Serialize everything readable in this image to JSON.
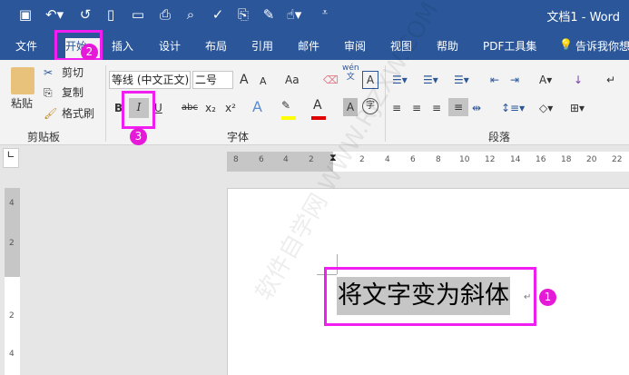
{
  "title": "文档1 - Word",
  "quick_access": [
    "save-icon",
    "undo-icon",
    "redo-icon",
    "new-icon",
    "open-icon",
    "print-icon",
    "preview-icon",
    "spell-icon",
    "attach-icon",
    "edit-icon",
    "touch-icon",
    "customize-icon"
  ],
  "tabs": [
    "文件",
    "开始",
    "插入",
    "设计",
    "布局",
    "引用",
    "邮件",
    "审阅",
    "视图",
    "帮助",
    "PDF工具集"
  ],
  "tell_me": "告诉我你想",
  "clipboard": {
    "paste": "粘贴",
    "cut": "剪切",
    "copy": "复制",
    "format_painter": "格式刷",
    "label": "剪贴板"
  },
  "font": {
    "name": "等线 (中文正文)",
    "size": "二号",
    "bold": "B",
    "italic": "I",
    "underline": "U",
    "strike": "abc",
    "sub": "x₂",
    "sup": "x²",
    "grow": "A",
    "shrink": "A",
    "case": "Aa",
    "pinyin_top": "wén",
    "pinyin_bottom": "文",
    "border_char": "A",
    "effect": "A",
    "shade": "A",
    "circle": "字",
    "label": "字体"
  },
  "paragraph": {
    "label": "段落"
  },
  "ruler_h": [
    "8",
    "6",
    "4",
    "2",
    "2",
    "4",
    "6",
    "8",
    "10",
    "12",
    "14",
    "16",
    "18",
    "20",
    "22"
  ],
  "ruler_v": [
    "4",
    "2",
    "2",
    "4"
  ],
  "document_text": "将文字变为斜体",
  "watermark": "软件自学网 WWW.RJZXW.COM",
  "badges": [
    "1",
    "2",
    "3"
  ],
  "colors": {
    "brand": "#2b579a",
    "highlight": "#f01ef0",
    "font_color": "#e00000",
    "highlight_yellow": "#ffff00"
  }
}
